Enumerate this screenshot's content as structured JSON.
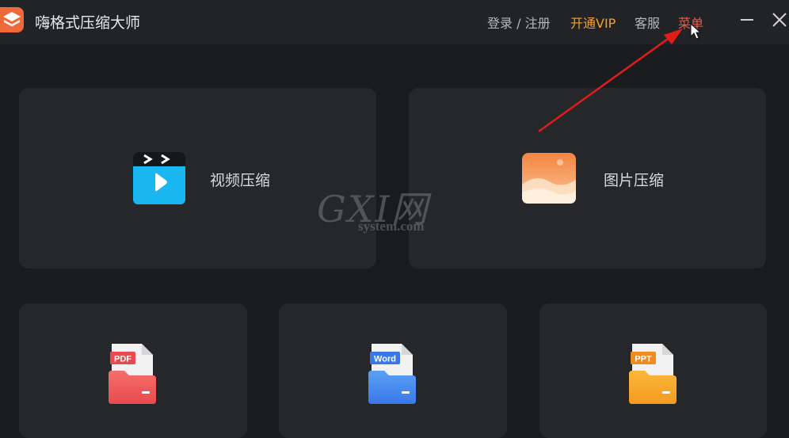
{
  "app": {
    "title": "嗨格式压缩大师"
  },
  "titlebar": {
    "login": "登录 / 注册",
    "vip": "开通VIP",
    "service": "客服",
    "menu": "菜单"
  },
  "cards": {
    "video": {
      "label": "视频压缩"
    },
    "image": {
      "label": "图片压缩"
    },
    "pdf": {
      "badge": "PDF"
    },
    "word": {
      "badge": "Word"
    },
    "ppt": {
      "badge": "PPT"
    }
  },
  "watermark": {
    "main": "GXI网",
    "sub": "system.com"
  },
  "colors": {
    "background": "#1a1b1f",
    "card": "#26272b",
    "vip": "#f1a12f",
    "menu_active": "#e85b4d",
    "annotation_arrow": "#e21b1b"
  },
  "icons": [
    "app-logo-icon",
    "video-clapper-icon",
    "image-photo-icon",
    "pdf-folder-icon",
    "word-folder-icon",
    "ppt-folder-icon",
    "minimize-icon",
    "close-icon",
    "mouse-cursor-icon"
  ]
}
